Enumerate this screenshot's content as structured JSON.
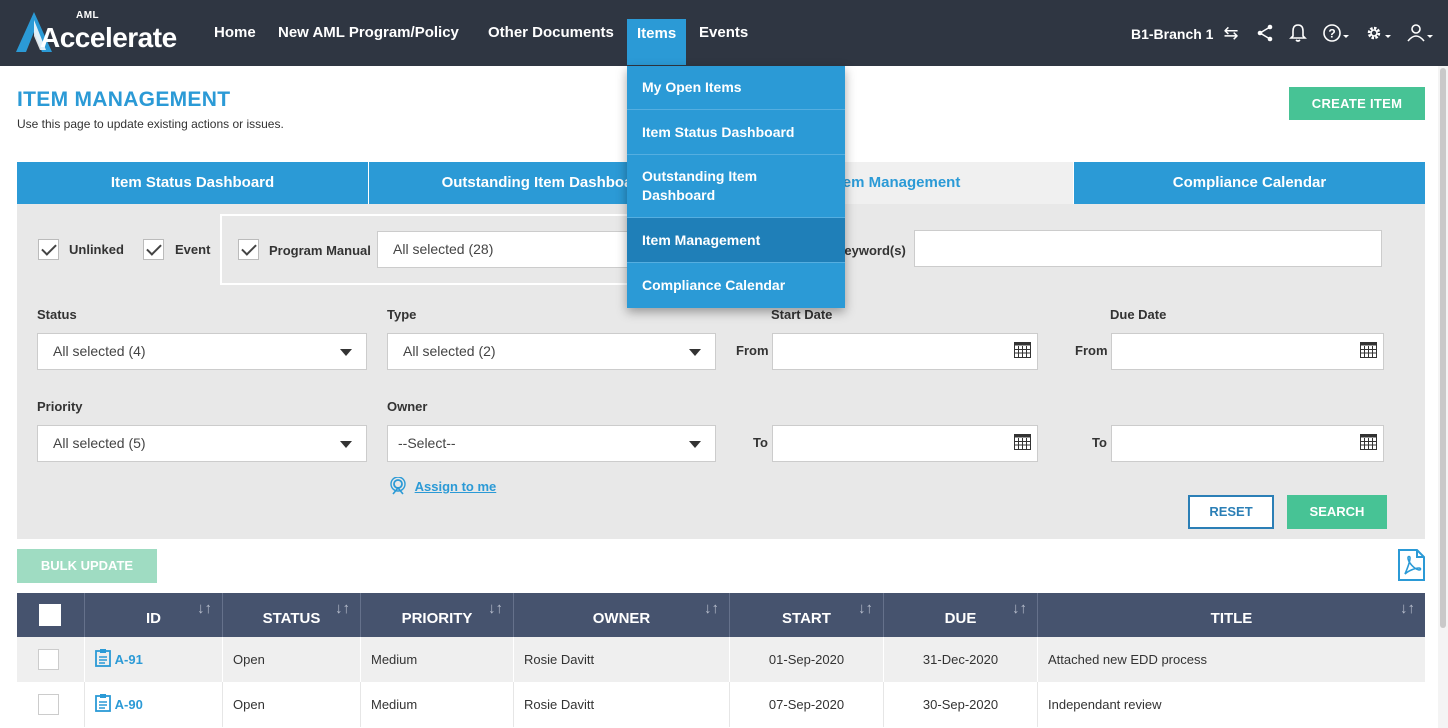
{
  "brand": {
    "prefix": "AML",
    "name": "Accelerate"
  },
  "nav": {
    "items": [
      {
        "label": "Home"
      },
      {
        "label": "New AML Program/Policy"
      },
      {
        "label": "Other Documents"
      },
      {
        "label": "Items"
      },
      {
        "label": "Events"
      }
    ],
    "branch": "B1-Branch 1",
    "icons": [
      "swap-icon",
      "share-icon",
      "bell-icon",
      "help-icon",
      "settings-icon",
      "user-icon"
    ]
  },
  "items_menu": [
    {
      "label": "My Open Items"
    },
    {
      "label": "Item Status Dashboard"
    },
    {
      "label": "Outstanding Item Dashboard"
    },
    {
      "label": "Item Management"
    },
    {
      "label": "Compliance Calendar"
    }
  ],
  "page": {
    "title": "ITEM MANAGEMENT",
    "subtitle": "Use this page to update existing actions or issues.",
    "create_label": "CREATE ITEM"
  },
  "tabs": [
    {
      "label": "Item Status Dashboard"
    },
    {
      "label": "Outstanding Item Dashboard"
    },
    {
      "label": "Item Management"
    },
    {
      "label": "Compliance Calendar"
    }
  ],
  "filters": {
    "unlinked": "Unlinked",
    "event": "Event",
    "program_manual": "Program Manual",
    "program_manual_value": "All selected (28)",
    "keywords_label": "Keyword(s)",
    "keywords_value": "",
    "status_label": "Status",
    "status_value": "All selected (4)",
    "type_label": "Type",
    "type_value": "All selected (2)",
    "start_date_label": "Start Date",
    "due_date_label": "Due Date",
    "from_label": "From",
    "to_label": "To",
    "priority_label": "Priority",
    "priority_value": "All selected (5)",
    "owner_label": "Owner",
    "owner_value": "--Select--",
    "assign_label": "Assign to me",
    "reset_label": "RESET",
    "search_label": "SEARCH"
  },
  "bulk_label": "BULK UPDATE",
  "table": {
    "columns": [
      "ID",
      "STATUS",
      "PRIORITY",
      "OWNER",
      "START",
      "DUE",
      "TITLE"
    ],
    "rows": [
      {
        "id": "A-91",
        "status": "Open",
        "priority": "Medium",
        "owner": "Rosie Davitt",
        "start": "01-Sep-2020",
        "due": "31-Dec-2020",
        "title": "Attached new EDD process"
      },
      {
        "id": "A-90",
        "status": "Open",
        "priority": "Medium",
        "owner": "Rosie Davitt",
        "start": "07-Sep-2020",
        "due": "30-Sep-2020",
        "title": "Independant review"
      }
    ]
  },
  "colors": {
    "accent": "#2b9ad6",
    "nav_bg": "#2f3642",
    "green": "#47c395",
    "table_header": "#46536e"
  }
}
